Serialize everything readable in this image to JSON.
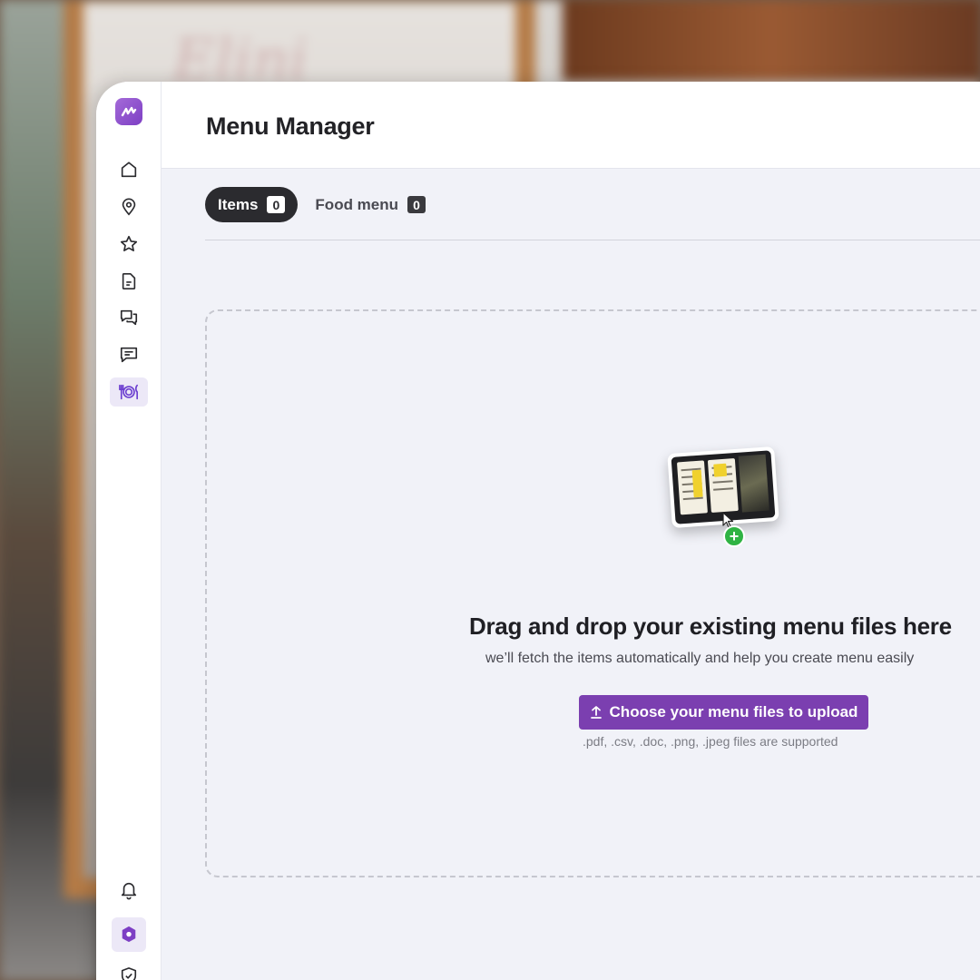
{
  "app": {
    "title": "Menu Manager",
    "brand_color": "#7b3fb0"
  },
  "sidebar": {
    "logo_icon": "brand-logo-icon",
    "items": [
      {
        "icon": "home-icon"
      },
      {
        "icon": "location-pin-icon"
      },
      {
        "icon": "star-icon"
      },
      {
        "icon": "document-icon"
      },
      {
        "icon": "chat-bubbles-icon"
      },
      {
        "icon": "message-icon"
      },
      {
        "icon": "dining-menu-icon",
        "active": true
      }
    ],
    "bottom_items": [
      {
        "icon": "bell-icon"
      },
      {
        "icon": "hexagon-icon",
        "active": true
      },
      {
        "icon": "shield-icon"
      }
    ]
  },
  "tabs": [
    {
      "label": "Items",
      "count": "0",
      "active": true
    },
    {
      "label": "Food menu",
      "count": "0",
      "active": false
    }
  ],
  "dropzone": {
    "title": "Drag and drop your existing menu files here",
    "subtitle": "we’ll fetch the items automatically and help you create menu easily",
    "button_label": "Choose your menu files to upload",
    "button_icon": "upload-icon",
    "hint": ".pdf, .csv, .doc, .png, .jpeg files are supported"
  }
}
